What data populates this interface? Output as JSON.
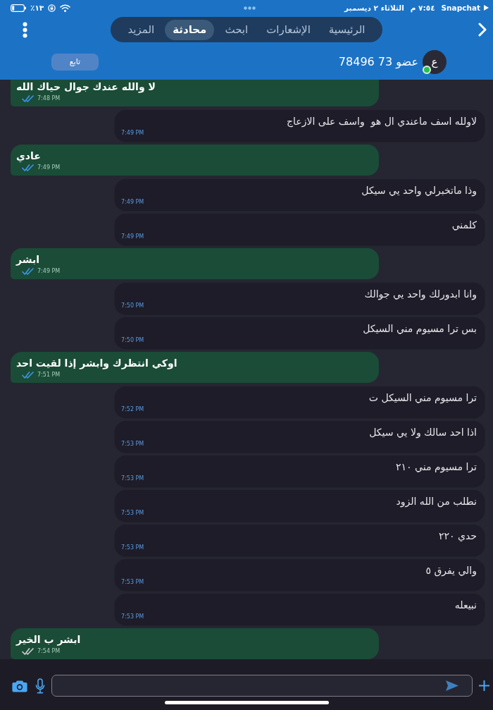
{
  "status_bar": {
    "battery": "١٣٪",
    "date": "الثلاثاء ٢ ديسمبر",
    "time": "٧:٥٤ م",
    "app": "Snapchat"
  },
  "nav": {
    "tabs": [
      {
        "label": "الرئيسية",
        "selected": false
      },
      {
        "label": "الإشعارات",
        "selected": false
      },
      {
        "label": "ابحث",
        "selected": false
      },
      {
        "label": "محادثة",
        "selected": true
      },
      {
        "label": "المزيد",
        "selected": false
      }
    ]
  },
  "profile": {
    "avatar_letter": "ع",
    "name": "عضو 73 78496",
    "online": true,
    "follow_button": "تابع"
  },
  "messages": [
    {
      "kind": "sent",
      "text": "لا والله عندك جوال حياك الله",
      "time": "7:48 PM",
      "read": true
    },
    {
      "kind": "received",
      "text": "لاولله اسف ماعندي ال هو  واسف على الازعاج",
      "time": "7:49 PM"
    },
    {
      "kind": "sent",
      "text": "عادي",
      "time": "7:49 PM",
      "read": true
    },
    {
      "kind": "received",
      "text": "وذا ماتخبرلي واحد يي سيكل",
      "time": "7:49 PM"
    },
    {
      "kind": "received",
      "text": "كلمني",
      "time": "7:49 PM"
    },
    {
      "kind": "sent",
      "text": "ابشر",
      "time": "7:49 PM",
      "read": true
    },
    {
      "kind": "received",
      "text": "وانا ابدورلك واحد يي جوالك",
      "time": "7:50 PM"
    },
    {
      "kind": "received",
      "text": "بس ترا مسيوم مني السيكل",
      "time": "7:50 PM"
    },
    {
      "kind": "sent",
      "text": "اوكي انتظرك وابشر إذا لقيت احد",
      "time": "7:51 PM",
      "read": true
    },
    {
      "kind": "received",
      "text": "ترا مسيوم مني السيكل ت",
      "time": "7:52 PM"
    },
    {
      "kind": "received",
      "text": "اذا احد سالك ولا يي سيكل",
      "time": "7:53 PM"
    },
    {
      "kind": "received",
      "text": "ترا مسيوم مني ٢١٠",
      "time": "7:53 PM"
    },
    {
      "kind": "received",
      "text": "نطلب من الله الزود",
      "time": "7:53 PM"
    },
    {
      "kind": "received",
      "text": "حدي ٢٢٠",
      "time": "7:53 PM"
    },
    {
      "kind": "received",
      "text": "والي يفرق ٥",
      "time": "7:53 PM"
    },
    {
      "kind": "received",
      "text": "نبيعله",
      "time": "7:53 PM"
    },
    {
      "kind": "sent",
      "text": "ابشر ب الخير",
      "time": "7:54 PM",
      "read": false
    }
  ]
}
